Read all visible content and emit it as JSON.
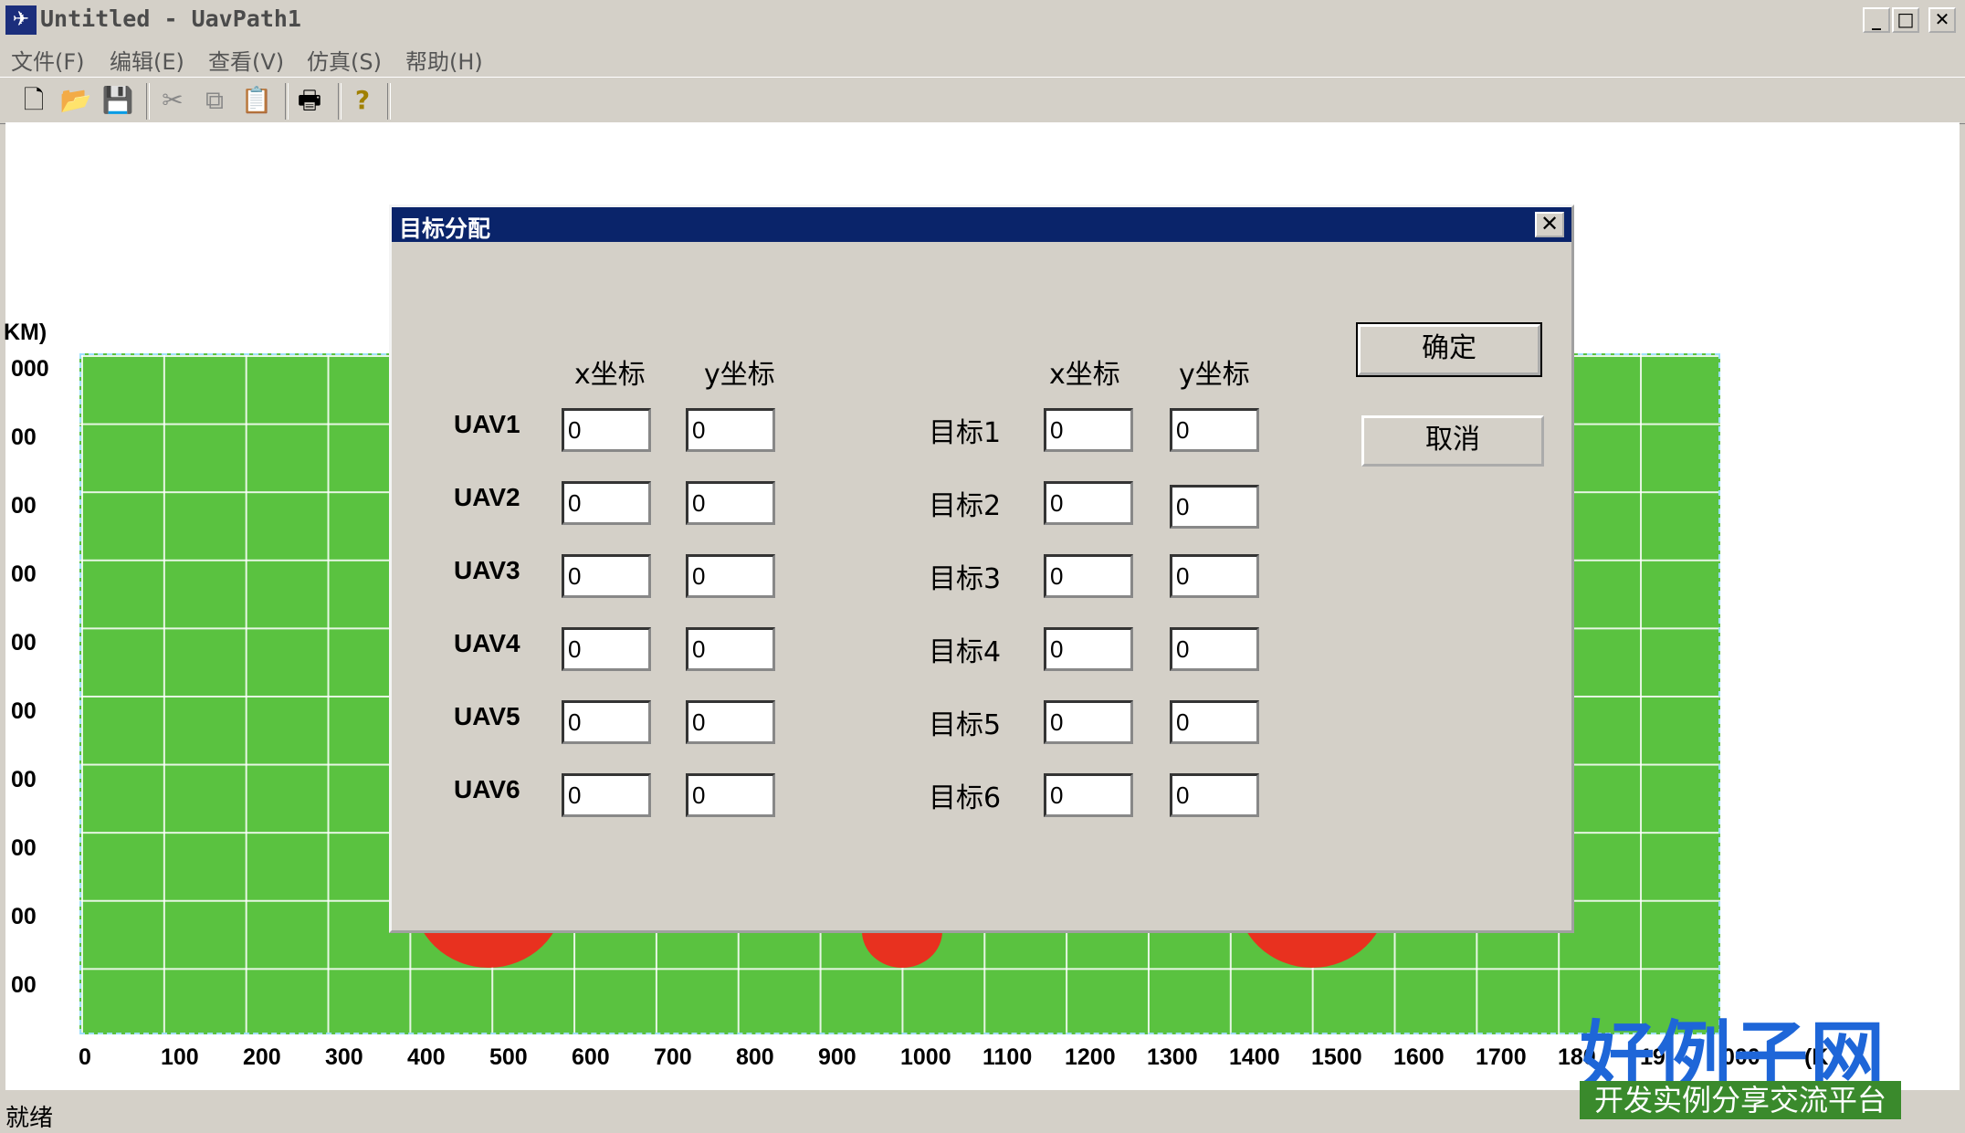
{
  "window": {
    "title": "Untitled - UavPath1",
    "min_symbol": "_",
    "max_symbol": "□",
    "close_symbol": "✕"
  },
  "menu": {
    "items": [
      "文件(F)",
      "编辑(E)",
      "查看(V)",
      "仿真(S)",
      "帮助(H)"
    ]
  },
  "toolbar": {
    "icons": [
      "new-file-icon",
      "open-folder-icon",
      "save-icon",
      "cut-icon",
      "copy-icon",
      "paste-icon",
      "print-icon",
      "help-icon"
    ],
    "glyphs": [
      "🗋",
      "📂",
      "💾",
      "✂",
      "⧉",
      "📋",
      "🖶",
      "?"
    ]
  },
  "plot": {
    "y_unit": "KM)",
    "y_ticks": [
      "000",
      "00",
      "00",
      "00",
      "00",
      "00",
      "00",
      "00",
      "00",
      "00"
    ],
    "x_ticks": [
      "0",
      "100",
      "200",
      "300",
      "400",
      "500",
      "600",
      "700",
      "800",
      "900",
      "1000",
      "1100",
      "1200",
      "1300",
      "1400",
      "1500",
      "1600",
      "1700",
      "180",
      "19",
      "000"
    ],
    "x_unit": "(K"
  },
  "dialog": {
    "title": "目标分配",
    "close_symbol": "✕",
    "header_x": "x坐标",
    "header_y": "y坐标",
    "ok_label": "确定",
    "cancel_label": "取消",
    "uavs": [
      {
        "label": "UAV1",
        "x": "0",
        "y": "0"
      },
      {
        "label": "UAV2",
        "x": "0",
        "y": "0"
      },
      {
        "label": "UAV3",
        "x": "0",
        "y": "0"
      },
      {
        "label": "UAV4",
        "x": "0",
        "y": "0"
      },
      {
        "label": "UAV5",
        "x": "0",
        "y": "0"
      },
      {
        "label": "UAV6",
        "x": "0",
        "y": "0"
      }
    ],
    "targets": [
      {
        "label": "目标1",
        "x": "0",
        "y": "0"
      },
      {
        "label": "目标2",
        "x": "0",
        "y": "0"
      },
      {
        "label": "目标3",
        "x": "0",
        "y": "0"
      },
      {
        "label": "目标4",
        "x": "0",
        "y": "0"
      },
      {
        "label": "目标5",
        "x": "0",
        "y": "0"
      },
      {
        "label": "目标6",
        "x": "0",
        "y": "0"
      }
    ]
  },
  "status": {
    "text": "就绪"
  },
  "watermark": {
    "logo_text": "好例子网",
    "logo_subtext": "开发实例分享交流平台"
  },
  "colors": {
    "plot_green": "#5ac240",
    "obstacle_red": "#e8311f",
    "dialog_title_blue": "#0a246a"
  }
}
